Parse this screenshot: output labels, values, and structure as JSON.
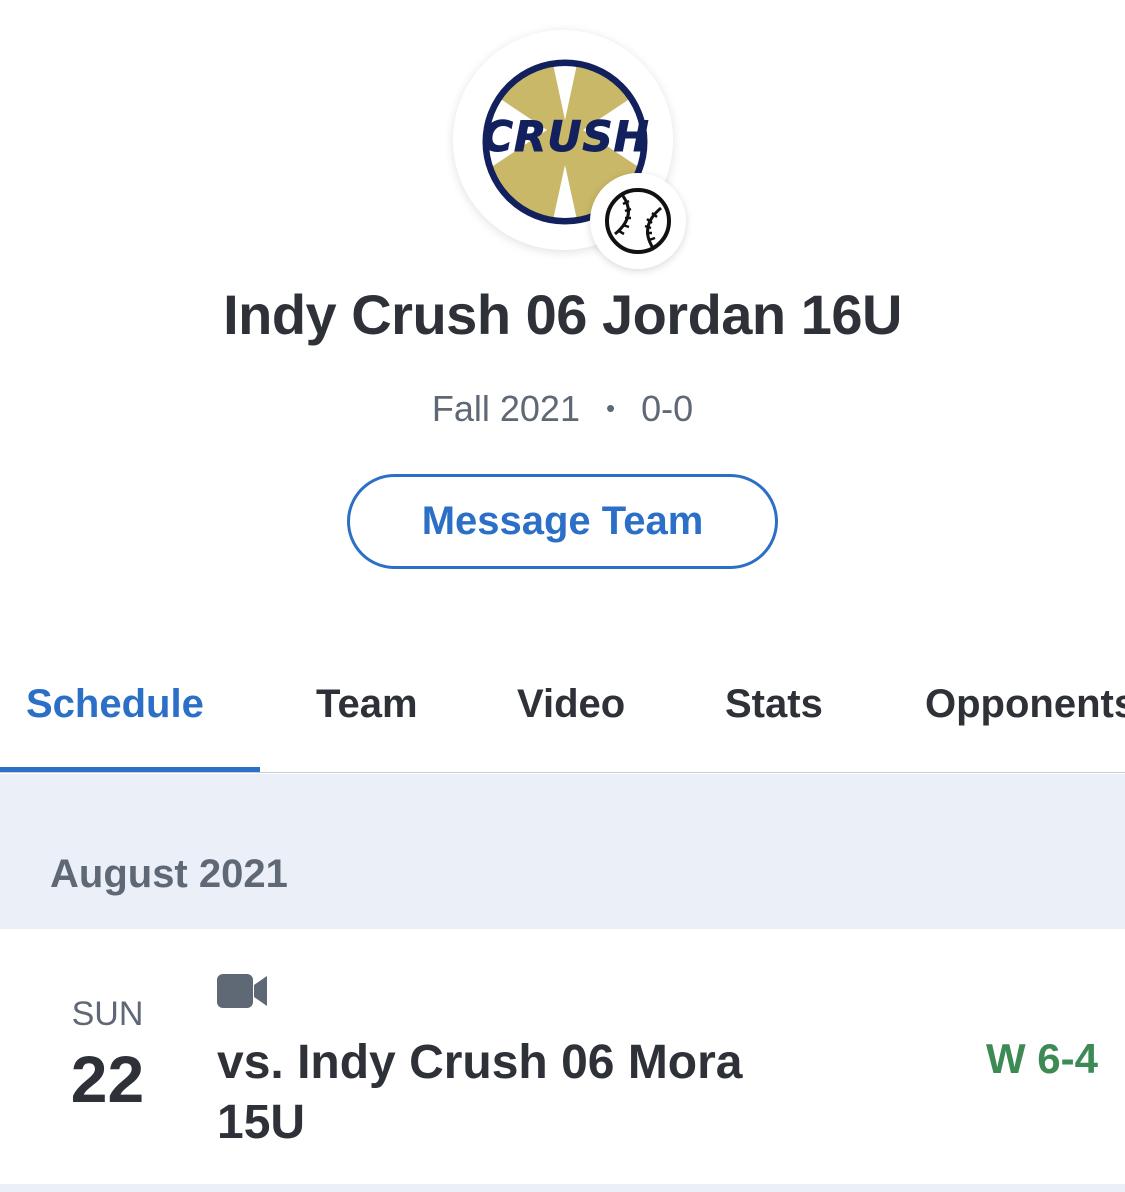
{
  "team": {
    "logo_text": "CRUSH",
    "name": "Indy Crush 06 Jordan 16U",
    "season": "Fall 2021",
    "separator": "•",
    "record": "0-0"
  },
  "actions": {
    "message_label": "Message Team"
  },
  "tabs": [
    {
      "label": "Schedule",
      "active": true
    },
    {
      "label": "Team",
      "active": false
    },
    {
      "label": "Video",
      "active": false
    },
    {
      "label": "Stats",
      "active": false
    },
    {
      "label": "Opponents",
      "active": false
    }
  ],
  "schedule": {
    "month": "August 2021",
    "games": [
      {
        "day_name": "SUN",
        "day_number": "22",
        "has_video": true,
        "opponent": "vs. Indy Crush 06 Mora 15U",
        "result": "W 6-4"
      }
    ]
  },
  "colors": {
    "accent": "#2c6fc6",
    "win": "#3d8a55",
    "logo_gold": "#c9b867",
    "logo_navy": "#13205e",
    "band": "#ebf0f8"
  },
  "icons": {
    "sport": "baseball-icon",
    "video": "video-camera-icon"
  }
}
